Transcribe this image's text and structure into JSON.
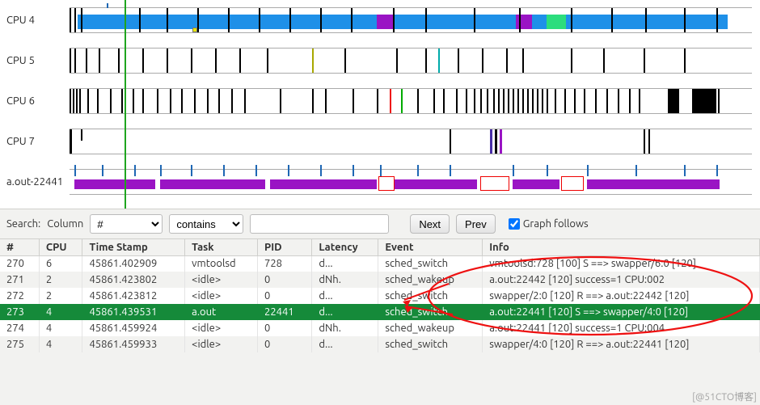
{
  "graph": {
    "rows": [
      {
        "label": "CPU 4"
      },
      {
        "label": "CPU 5"
      },
      {
        "label": "CPU 6"
      },
      {
        "label": "CPU 7"
      },
      {
        "label": "a.out-22441"
      }
    ]
  },
  "search": {
    "label": "Search:",
    "column_label": "Column",
    "column": "#",
    "op": "contains",
    "text": "",
    "next": "Next",
    "prev": "Prev",
    "graph_follows": "Graph follows",
    "checked": true
  },
  "table": {
    "headers": [
      "#",
      "CPU",
      "Time Stamp",
      "Task",
      "PID",
      "Latency",
      "Event",
      "Info"
    ],
    "rows": [
      {
        "n": "270",
        "cpu": "6",
        "ts": "45861.402909",
        "task": "vmtoolsd",
        "pid": "728",
        "lat": "d...",
        "evt": "sched_switch",
        "info": "vmtoolsd:728 [100] S ==> swapper/6:0 [120]",
        "sel": false
      },
      {
        "n": "271",
        "cpu": "2",
        "ts": "45861.423802",
        "task": "<idle>",
        "pid": "0",
        "lat": "dNh.",
        "evt": "sched_wakeup",
        "info": "a.out:22442 [120] success=1 CPU:002",
        "sel": false
      },
      {
        "n": "272",
        "cpu": "2",
        "ts": "45861.423812",
        "task": "<idle>",
        "pid": "0",
        "lat": "d...",
        "evt": "sched_switch",
        "info": "swapper/2:0 [120] R ==> a.out:22442 [120]",
        "sel": false
      },
      {
        "n": "273",
        "cpu": "4",
        "ts": "45861.439531",
        "task": "a.out",
        "pid": "22441",
        "lat": "d...",
        "evt": "sched_switch",
        "info": "a.out:22441 [120] S ==> swapper/4:0 [120]",
        "sel": true
      },
      {
        "n": "274",
        "cpu": "4",
        "ts": "45861.459924",
        "task": "<idle>",
        "pid": "0",
        "lat": "dNh.",
        "evt": "sched_wakeup",
        "info": "a.out:22441 [120] success=1 CPU:004",
        "sel": false
      },
      {
        "n": "275",
        "cpu": "4",
        "ts": "45861.459933",
        "task": "<idle>",
        "pid": "0",
        "lat": "d...",
        "evt": "sched_switch",
        "info": "swapper/4:0 [120] R ==> a.out:22441 [120]",
        "sel": false
      }
    ]
  },
  "watermark": "[@51CTO博客]"
}
